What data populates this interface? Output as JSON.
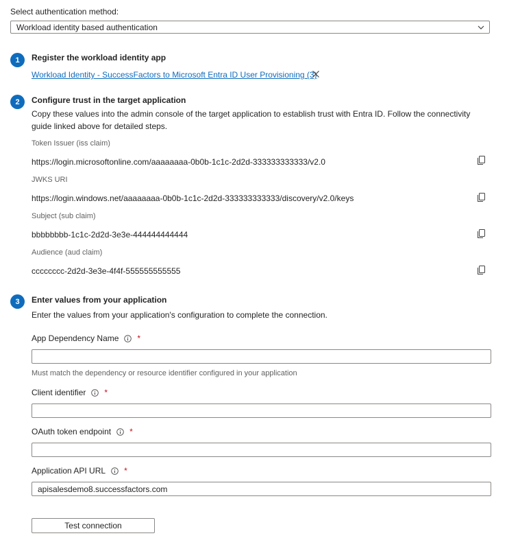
{
  "auth_method": {
    "label": "Select authentication method:",
    "selected": "Workload identity based authentication"
  },
  "steps": [
    {
      "number": "1",
      "title": "Register the workload identity app"
    },
    {
      "number": "2",
      "title": "Configure trust in the target application"
    },
    {
      "number": "3",
      "title": "Enter values from your application"
    }
  ],
  "step1": {
    "link": "Workload Identity - SuccessFactors to Microsoft Entra ID User Provisioning (3)"
  },
  "step2": {
    "description": "Copy these values into the admin console of the target application to establish trust with Entra ID. Follow the connectivity guide linked above for detailed steps.",
    "fields": [
      {
        "label": "Token Issuer (iss claim)",
        "value": "https://login.microsoftonline.com/aaaaaaaa-0b0b-1c1c-2d2d-333333333333/v2.0"
      },
      {
        "label": "JWKS URI",
        "value": "https://login.windows.net/aaaaaaaa-0b0b-1c1c-2d2d-333333333333/discovery/v2.0/keys"
      },
      {
        "label": "Subject (sub claim)",
        "value": "bbbbbbbb-1c1c-2d2d-3e3e-444444444444"
      },
      {
        "label": "Audience (aud claim)",
        "value": "cccccccc-2d2d-3e3e-4f4f-555555555555"
      }
    ]
  },
  "step3": {
    "description": "Enter the values from your application's configuration to complete the connection.",
    "required_mark": "*",
    "fields": [
      {
        "label": "App Dependency Name",
        "value": "",
        "hint": "Must match the dependency or resource identifier configured in your application"
      },
      {
        "label": "Client identifier",
        "value": ""
      },
      {
        "label": "OAuth token endpoint",
        "value": ""
      },
      {
        "label": "Application API URL",
        "value": "apisalesdemo8.successfactors.com"
      }
    ]
  },
  "buttons": {
    "test_connection": "Test connection"
  },
  "colors": {
    "accent": "#0f6cbd",
    "required": "#c50f1f"
  },
  "icons": {
    "dropdown": "chevron-down-icon",
    "dismiss": "close-icon",
    "copy": "copy-icon",
    "info": "info-icon"
  }
}
